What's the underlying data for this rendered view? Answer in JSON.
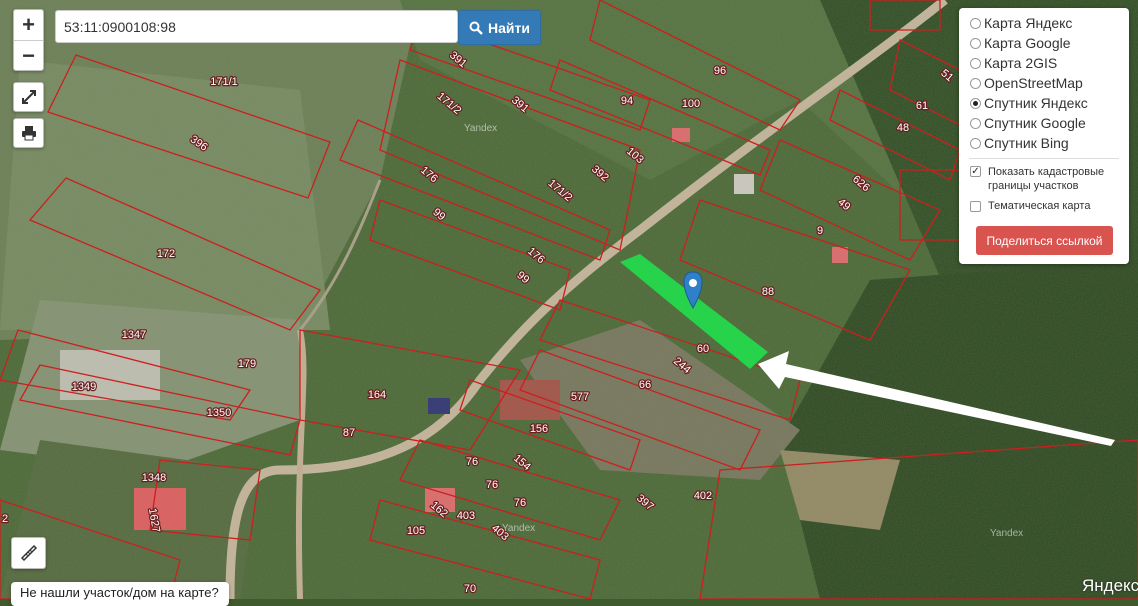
{
  "search": {
    "value": "53:11:0900108:98",
    "button_label": "Найти"
  },
  "zoom": {
    "in": "+",
    "out": "−"
  },
  "layers": [
    {
      "label": "Карта Яндекс",
      "selected": false
    },
    {
      "label": "Карта Google",
      "selected": false
    },
    {
      "label": "Карта 2GIS",
      "selected": false
    },
    {
      "label": "OpenStreetMap",
      "selected": false
    },
    {
      "label": "Спутник Яндекс",
      "selected": true
    },
    {
      "label": "Спутник Google",
      "selected": false
    },
    {
      "label": "Спутник Bing",
      "selected": false
    }
  ],
  "options": {
    "cadastral_label": "Показать кадастровые границы участков",
    "cadastral_checked": true,
    "thematic_label": "Тематическая карта",
    "thematic_checked": false
  },
  "share_label": "Поделиться ссылкой",
  "not_found_label": "Не нашли участок/дом на карте?",
  "provider_logo": "Яндекс",
  "watermark": "Yandex",
  "plot_labels": [
    "171/1",
    "396",
    "172",
    "1347",
    "1349",
    "1350",
    "1348",
    "1627",
    "179",
    "164",
    "87",
    "391",
    "171/2",
    "391",
    "176",
    "99",
    "171/2",
    "392",
    "176",
    "99",
    "94",
    "100",
    "96",
    "103",
    "61",
    "48",
    "626",
    "49",
    "9",
    "88",
    "60",
    "244",
    "66",
    "577",
    "156",
    "76",
    "154",
    "76",
    "76",
    "403",
    "403",
    "105",
    "162",
    "397",
    "402",
    "70",
    "51",
    "2"
  ],
  "colors": {
    "highlight": "#26d34a",
    "boundary": "#cc1f1f",
    "share": "#d9534f",
    "search": "#337ab7"
  }
}
